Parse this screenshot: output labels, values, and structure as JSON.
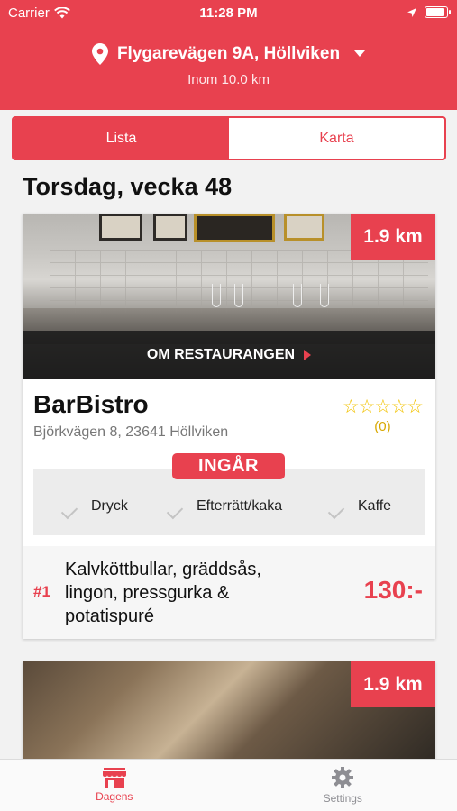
{
  "status_bar": {
    "carrier": "Carrier",
    "time": "11:28 PM"
  },
  "header": {
    "address": "Flygarevägen 9A, Höllviken",
    "radius": "Inom 10.0 km"
  },
  "segments": {
    "list_label": "Lista",
    "map_label": "Karta",
    "active": "list"
  },
  "day_title": "Torsdag, vecka 48",
  "restaurants": [
    {
      "distance": "1.9 km",
      "about_label": "OM RESTAURANGEN",
      "name": "BarBistro",
      "address": "Björkvägen 8, 23641 Höllviken",
      "stars": "☆☆☆☆☆",
      "rating_count": "(0)",
      "includes_label": "INGÅR",
      "includes": [
        "Dryck",
        "Efterrätt/kaka",
        "Kaffe"
      ],
      "dish": {
        "rank": "#1",
        "name": "Kalvköttbullar, gräddsås, lingon, pressgurka & potatispuré",
        "price": "130:-"
      }
    },
    {
      "distance": "1.9 km"
    }
  ],
  "tabbar": {
    "today_label": "Dagens",
    "settings_label": "Settings"
  },
  "colors": {
    "accent": "#e8414f",
    "star": "#f2c200"
  }
}
